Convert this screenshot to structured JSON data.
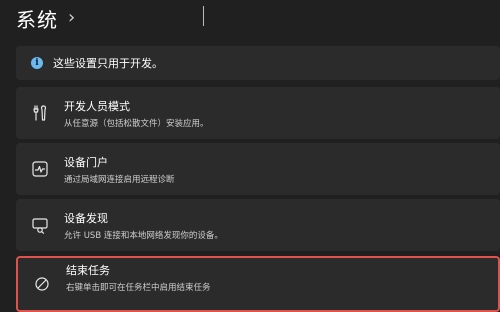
{
  "header": {
    "title": "系统",
    "chevron": "›"
  },
  "info_bar": {
    "icon": "info-icon",
    "text": "这些设置只用于开发。"
  },
  "cards": [
    {
      "icon": "developer-tools-icon",
      "title": "开发人员模式",
      "subtitle": "从任意源（包括松散文件）安装应用。"
    },
    {
      "icon": "device-portal-icon",
      "title": "设备门户",
      "subtitle": "通过局域网连接启用远程诊断"
    },
    {
      "icon": "device-discovery-icon",
      "title": "设备发现",
      "subtitle": "允许 USB 连接和本地网络发现你的设备。"
    },
    {
      "icon": "end-task-icon",
      "title": "结束任务",
      "subtitle": "右键单击即可在任务栏中启用结束任务"
    }
  ],
  "colors": {
    "background": "#202020",
    "card": "#2b2b2b",
    "highlight_border": "#e0534c",
    "info_accent": "#6cb8f0"
  }
}
